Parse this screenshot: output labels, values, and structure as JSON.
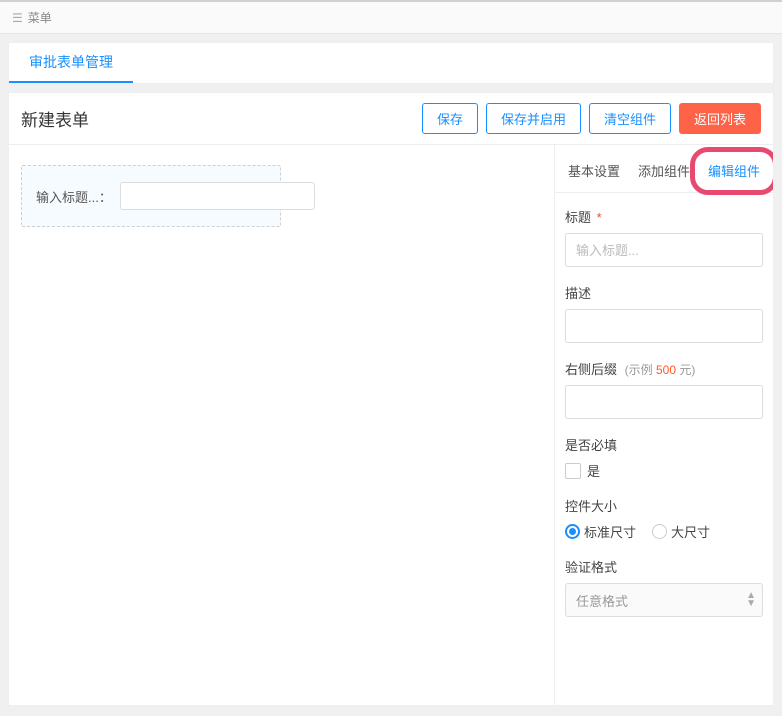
{
  "topbar": {
    "menu_label": "菜单"
  },
  "header_tab": {
    "label": "审批表单管理"
  },
  "card": {
    "title": "新建表单",
    "buttons": {
      "save": "保存",
      "save_enable": "保存并启用",
      "clear": "清空组件",
      "back": "返回列表"
    }
  },
  "canvas": {
    "widget_label": "输入标题...："
  },
  "side_tabs": {
    "basic": "基本设置",
    "add": "添加组件",
    "edit": "编辑组件"
  },
  "panel": {
    "title": {
      "label": "标题",
      "required": true,
      "placeholder": "输入标题..."
    },
    "desc": {
      "label": "描述"
    },
    "suffix": {
      "label": "右侧后缀",
      "hint_prefix": "(示例 ",
      "hint_num": "500",
      "hint_unit": " 元)"
    },
    "required_field": {
      "label": "是否必填",
      "option": "是"
    },
    "size": {
      "label": "控件大小",
      "std": "标准尺寸",
      "lg": "大尺寸"
    },
    "validate": {
      "label": "验证格式",
      "selected": "任意格式"
    }
  }
}
